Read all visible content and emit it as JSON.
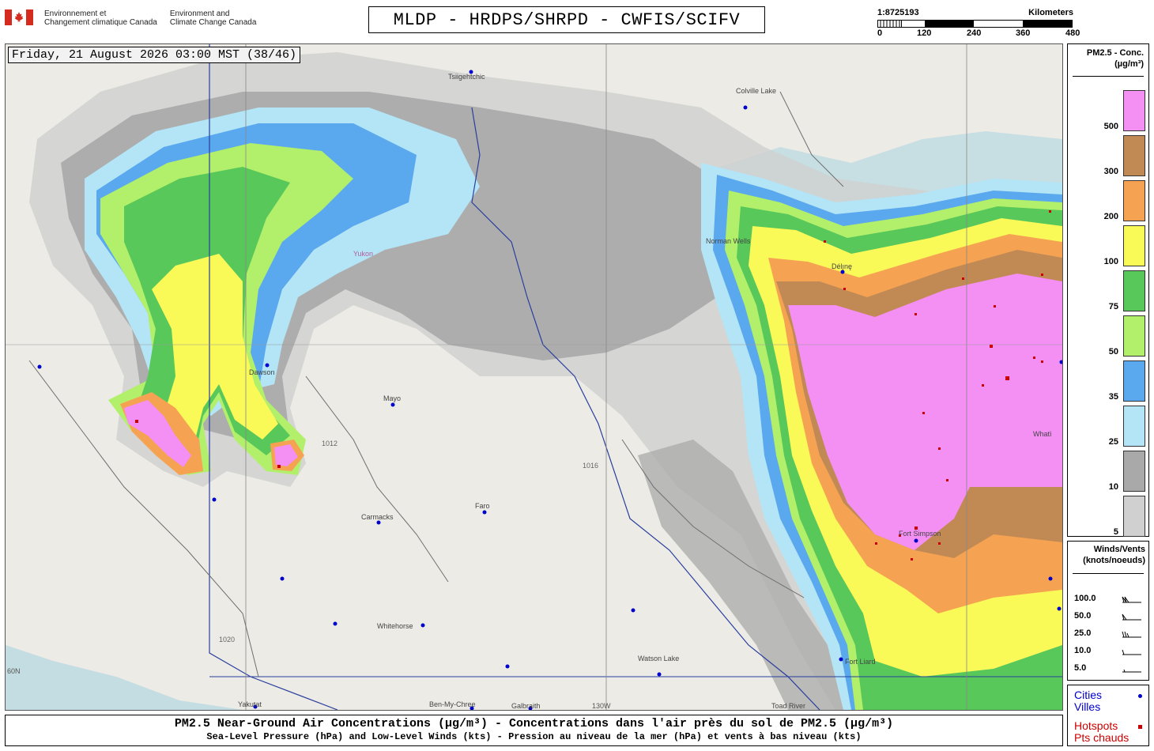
{
  "header": {
    "dept_fr": [
      "Environnement et",
      "Changement climatique Canada"
    ],
    "dept_en": [
      "Environment and",
      "Climate Change Canada"
    ],
    "title": "MLDP - HRDPS/SHRPD - CWFIS/SCIFV",
    "scale": {
      "ratio": "1:8725193",
      "unit": "Kilometers",
      "labels": [
        "0",
        "120",
        "240",
        "360",
        "480"
      ]
    }
  },
  "map": {
    "datetime": "Friday, 21 August 2026 03:00 MST (38/46)",
    "cities": [
      "Tsiigehtchic",
      "Colville Lake",
      "Norman Wells",
      "Délı̨nę",
      "Mayo",
      "Dawson",
      "Faro",
      "Carmacks",
      "Whitehorse",
      "Watson Lake",
      "Fort Simpson",
      "Fort Liard",
      "Toad River",
      "Yakutat",
      "Ben-My-Chree",
      "Galbraith",
      "Whatì",
      "Yukon"
    ],
    "isobar_labels": [
      "1012",
      "1016",
      "1020"
    ],
    "graticule_labels": [
      "60N",
      "130W"
    ],
    "colors": {
      "land": "#ecebe6",
      "water": "#aad3df",
      "border": "#2a3f9e",
      "city": "#0000cc",
      "hotspot": "#cc0000"
    }
  },
  "legend": {
    "title": [
      "PM2.5 - Conc.",
      "(µg/m³)"
    ],
    "bins": [
      {
        "label": "500",
        "color": "#f48ff4"
      },
      {
        "label": "300",
        "color": "#c18a55"
      },
      {
        "label": "200",
        "color": "#f5a352"
      },
      {
        "label": "100",
        "color": "#f9f958"
      },
      {
        "label": "75",
        "color": "#58c85a"
      },
      {
        "label": "50",
        "color": "#b2ef6a"
      },
      {
        "label": "35",
        "color": "#5aa8ee"
      },
      {
        "label": "25",
        "color": "#b3e5f6"
      },
      {
        "label": "10",
        "color": "#a9a9a9"
      },
      {
        "label": "5",
        "color": "#d0d0d0"
      }
    ],
    "winds_title": [
      "Winds/Vents",
      "(knots/noeuds)"
    ],
    "winds": [
      "100.0",
      "50.0",
      "25.0",
      "10.0",
      "5.0"
    ],
    "points": {
      "cities": [
        "Cities",
        "Villes"
      ],
      "hotspots": [
        "Hotspots",
        "Pts chauds"
      ]
    }
  },
  "caption": {
    "main": "PM2.5 Near-Ground Air Concentrations (µg/m³) - Concentrations dans l'air près du sol de PM2.5 (µg/m³)",
    "sub": "Sea-Level Pressure (hPa) and Low-Level Winds (kts) - Pression au niveau de la mer (hPa) et vents à bas niveau (kts)"
  }
}
